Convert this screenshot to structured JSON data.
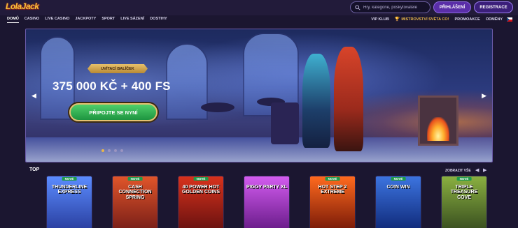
{
  "header": {
    "logo": "LolaJack",
    "search_placeholder": "Hry, kategorie, poskytovatelé",
    "login_label": "PŘIHLÁŠENÍ",
    "register_label": "REGISTRACE"
  },
  "nav": {
    "left": [
      "DOMŮ",
      "CASINO",
      "LIVE CASINO",
      "JACKPOTY",
      "SPORT",
      "LIVE SÁZENÍ",
      "DOSTIHY"
    ],
    "right": {
      "vip": "VIP KLUB",
      "championship": "MISTROVSTVÍ SVĚTA CO!",
      "promotions": "PROMOAKCE",
      "rewards": "ODMĚNY"
    }
  },
  "hero": {
    "badge": "UVÍTACÍ BALÍČEK",
    "title": "375 000 KČ + 400 FS",
    "cta": "PŘIPOJTE SE NYNÍ",
    "slides": 4,
    "active_slide": 1
  },
  "top": {
    "title": "TOP",
    "show_all": "ZOBRAZIT VŠE",
    "games": [
      {
        "tag": "NOVÉ",
        "name": "THUNDERLINE EXPRESS",
        "colors": [
          "#2a3fa0",
          "#5b8cff"
        ]
      },
      {
        "tag": "NOVÉ",
        "name": "CASH CONNECTION SPRING",
        "colors": [
          "#7a1f18",
          "#e0552a"
        ]
      },
      {
        "tag": "NOVÉ",
        "name": "40 POWER HOT GOLDEN COINS",
        "colors": [
          "#6a1210",
          "#d8321c"
        ]
      },
      {
        "tag": "",
        "name": "PIGGY PARTY XL",
        "colors": [
          "#6a1c8a",
          "#d35cf0"
        ]
      },
      {
        "tag": "NOVÉ",
        "name": "HOT STEP 2 EXTREME",
        "colors": [
          "#7a1a08",
          "#ff6a1e"
        ]
      },
      {
        "tag": "NOVÉ",
        "name": "COIN WIN",
        "colors": [
          "#102a7a",
          "#3c74e0"
        ]
      },
      {
        "tag": "NOVÉ",
        "name": "TRIPLE TREASURE COVE",
        "colors": [
          "#3a5020",
          "#8ab040"
        ]
      }
    ]
  }
}
